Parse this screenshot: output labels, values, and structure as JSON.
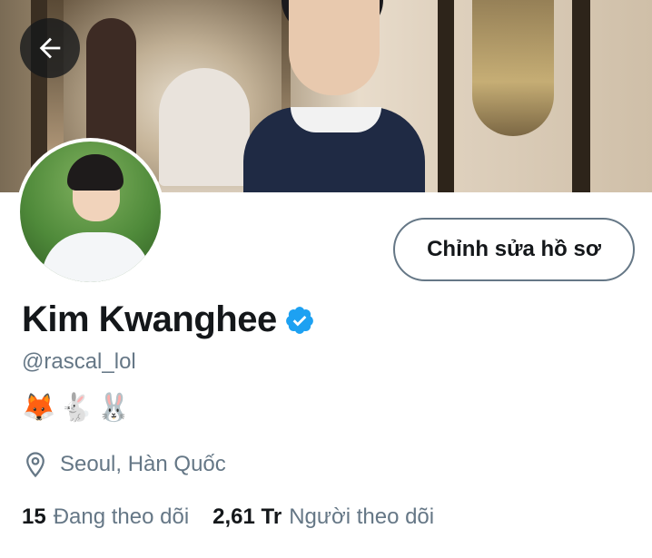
{
  "header": {
    "back_icon": "arrow-left-icon"
  },
  "profile": {
    "edit_label": "Chỉnh sửa hồ sơ",
    "display_name": "Kim Kwanghee",
    "verified_icon": "verified-badge-icon",
    "handle": "@rascal_lol",
    "bio": "🦊🐇🐰",
    "location_icon": "location-pin-icon",
    "location": "Seoul, Hàn Quốc",
    "following_count": "15",
    "following_label": "Đang theo dõi",
    "followers_count": "2,61 Tr",
    "followers_label": "Người theo dõi"
  },
  "colors": {
    "accent": "#1DA1F2",
    "text_primary": "#14171A",
    "text_secondary": "#657786"
  }
}
